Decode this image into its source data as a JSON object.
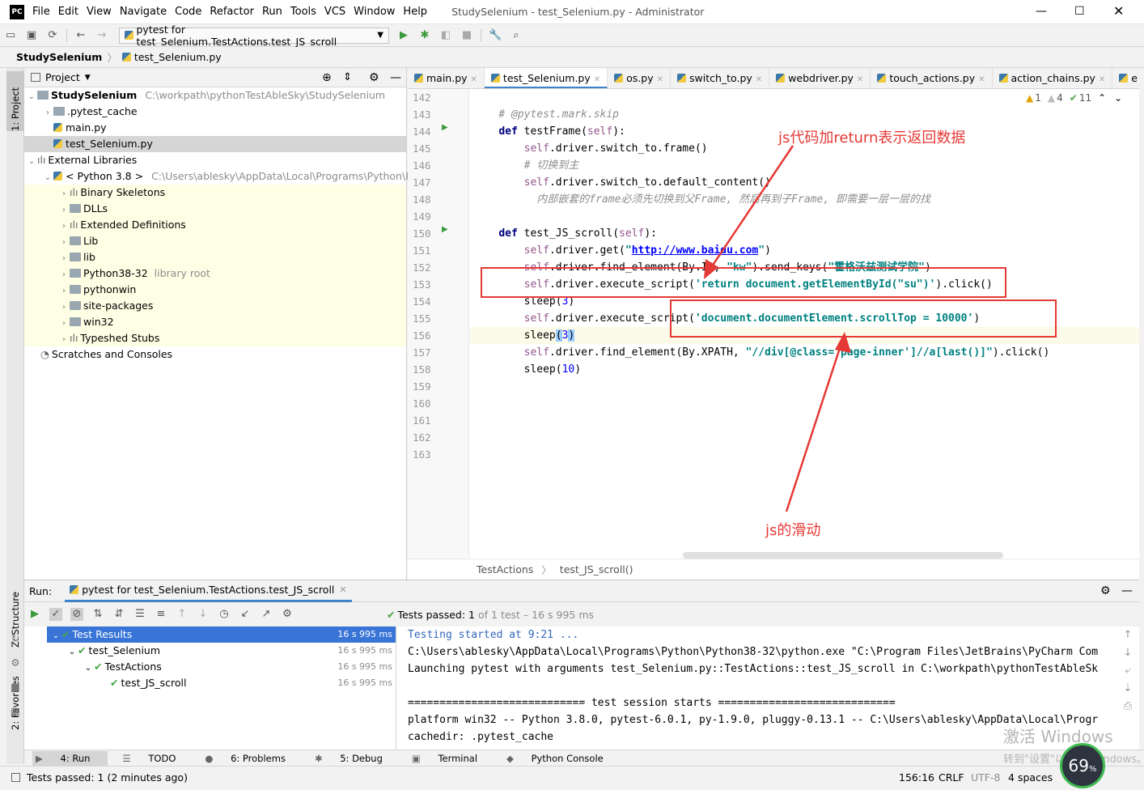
{
  "window": {
    "title": "StudySelenium - test_Selenium.py - Administrator",
    "menu": [
      "File",
      "Edit",
      "View",
      "Navigate",
      "Code",
      "Refactor",
      "Run",
      "Tools",
      "VCS",
      "Window",
      "Help"
    ]
  },
  "toolbar": {
    "run_config": "pytest for test_Selenium.TestActions.test_JS_scroll"
  },
  "breadcrumb": {
    "project": "StudySelenium",
    "file": "test_Selenium.py"
  },
  "sidebar_left": {
    "project_tab": "1: Project",
    "structure_tab": "Z: Structure",
    "favorites_tab": "2: Favorites"
  },
  "project": {
    "header": "Project",
    "root_name": "StudySelenium",
    "root_path": "C:\\workpath\\pythonTestAbleSky\\StudySelenium",
    "items": [
      {
        "label": ".pytest_cache"
      },
      {
        "label": "main.py"
      },
      {
        "label": "test_Selenium.py"
      }
    ],
    "external": "External Libraries",
    "python": "< Python 3.8 >",
    "python_path": "C:\\Users\\ablesky\\AppData\\Local\\Programs\\Python\\Pyth",
    "libs": [
      {
        "label": "Binary Skeletons",
        "note": ""
      },
      {
        "label": "DLLs",
        "note": ""
      },
      {
        "label": "Extended Definitions",
        "note": ""
      },
      {
        "label": "Lib",
        "note": ""
      },
      {
        "label": "lib",
        "note": ""
      },
      {
        "label": "Python38-32",
        "note": "library root"
      },
      {
        "label": "pythonwin",
        "note": ""
      },
      {
        "label": "site-packages",
        "note": ""
      },
      {
        "label": "win32",
        "note": ""
      },
      {
        "label": "Typeshed Stubs",
        "note": ""
      }
    ],
    "scratches": "Scratches and Consoles"
  },
  "editor": {
    "tabs": [
      "main.py",
      "test_Selenium.py",
      "os.py",
      "switch_to.py",
      "webdriver.py",
      "touch_actions.py",
      "action_chains.py",
      "e"
    ],
    "active_tab": "test_Selenium.py",
    "inspections": {
      "warn1": "1",
      "warn2": "4",
      "ok": "11"
    },
    "line_numbers": [
      "142",
      "143",
      "144",
      "145",
      "146",
      "147",
      "148",
      "149",
      "150",
      "151",
      "152",
      "153",
      "154",
      "155",
      "156",
      "157",
      "158",
      "159",
      "160",
      "161",
      "162",
      "163"
    ],
    "breadcrumb_class": "TestActions",
    "breadcrumb_method": "test_JS_scroll()"
  },
  "annotations": {
    "top": "js代码加return表示返回数据",
    "bottom": "js的滑动"
  },
  "run": {
    "label": "Run:",
    "tab": "pytest for test_Selenium.TestActions.test_JS_scroll",
    "status": "Tests passed:",
    "status_count": "1",
    "status_detail": "of 1 test – 16 s 995 ms",
    "tree": [
      {
        "label": "Test Results",
        "time": "16 s 995 ms"
      },
      {
        "label": "test_Selenium",
        "time": "16 s 995 ms"
      },
      {
        "label": "TestActions",
        "time": "16 s 995 ms"
      },
      {
        "label": "test_JS_scroll",
        "time": "16 s 995 ms"
      }
    ],
    "console": [
      "Testing started at 9:21 ...",
      "C:\\Users\\ablesky\\AppData\\Local\\Programs\\Python\\Python38-32\\python.exe \"C:\\Program Files\\JetBrains\\PyCharm Com",
      "Launching pytest with arguments test_Selenium.py::TestActions::test_JS_scroll in C:\\workpath\\pythonTestAbleSk",
      "",
      "============================ test session starts ============================",
      "platform win32 -- Python 3.8.0, pytest-6.0.1, py-1.9.0, pluggy-0.13.1 -- C:\\Users\\ablesky\\AppData\\Local\\Progr",
      "cachedir: .pytest_cache"
    ]
  },
  "bottom_tabs": [
    "4: Run",
    "TODO",
    "6: Problems",
    "5: Debug",
    "Terminal",
    "Python Console"
  ],
  "statusbar": {
    "message": "Tests passed: 1 (2 minutes ago)",
    "position": "156:16",
    "line_sep": "CRLF",
    "encoding": "UTF-8",
    "indent": "4 spaces",
    "widget": "69",
    "watermark1": "激活 Windows",
    "watermark2": "转到\"设置\"以激活 Windows。"
  },
  "colors": {
    "accent": "#3875d7",
    "annotation": "#e53935",
    "pass": "#4aa54a"
  }
}
